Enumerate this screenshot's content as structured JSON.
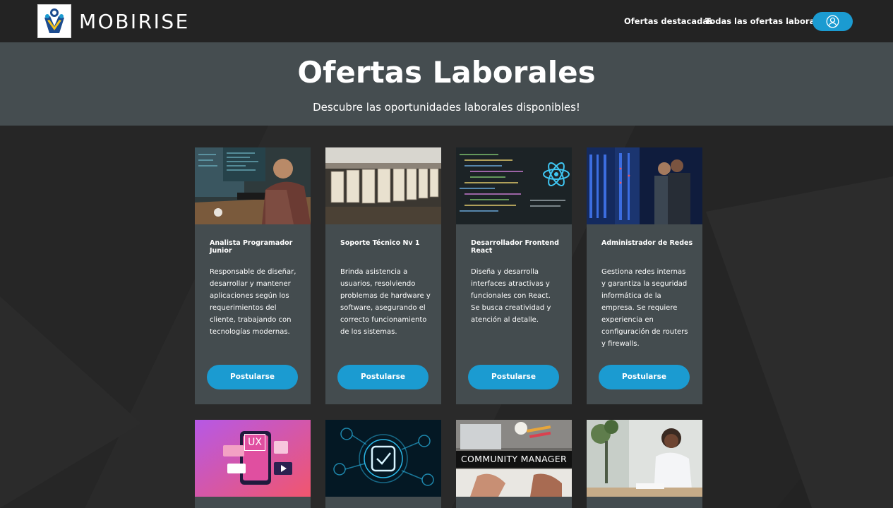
{
  "nav": {
    "brand": "MOBIRISE",
    "links": [
      "Ofertas destacadas",
      "Todas las ofertas laborales"
    ],
    "user_icon": "user-icon"
  },
  "hero": {
    "title": "Ofertas Laborales",
    "subtitle": "Descubre las oportunidades laborales disponibles!"
  },
  "apply_label": "Postularse",
  "cards": [
    {
      "title": "Analista Programador Junior",
      "description": "Responsable de diseñar, desarrollar y mantener aplicaciones según los requerimientos del cliente, trabajando con tecnologías modernas."
    },
    {
      "title": "Soporte Técnico Nv 1",
      "description": "Brinda asistencia a usuarios, resolviendo problemas de hardware y software, asegurando el correcto funcionamiento de los sistemas."
    },
    {
      "title": "Desarrollador Frontend React",
      "description": "Diseña y desarrolla interfaces atractivas y funcionales con React. Se busca creatividad y atención al detalle."
    },
    {
      "title": "Administrador de Redes",
      "description": "Gestiona redes internas y garantiza la seguridad informática de la empresa. Se requiere experiencia en configuración de routers y firewalls."
    }
  ],
  "image_cards": [
    {
      "image_text": "UX"
    },
    {
      "image_text": ""
    },
    {
      "image_text": "COMMUNITY MANAGER"
    },
    {
      "image_text": ""
    }
  ],
  "colors": {
    "accent": "#1b9bd1",
    "card_bg": "#444c4f",
    "hero_bg": "#454d50",
    "page_bg": "#232323"
  }
}
